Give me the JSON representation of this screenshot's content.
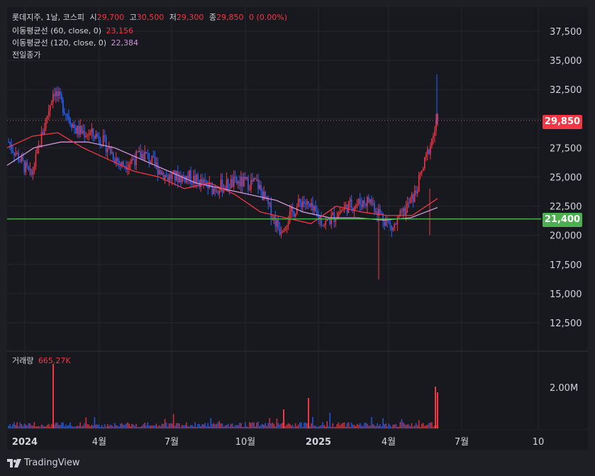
{
  "legend": {
    "symbol": "롯데지주",
    "interval": "1날",
    "market": "코스피",
    "open_label": "시",
    "open": "29,700",
    "high_label": "고",
    "high": "30,500",
    "low_label": "저",
    "low": "29,300",
    "close_label": "종",
    "close": "29,850",
    "change": "0 (0.00%)",
    "ma60_label": "이동평균선 (60, close, 0)",
    "ma60_value": "23,156",
    "ma120_label": "이동평균선 (120, close, 0)",
    "ma120_value": "22,384",
    "prev_close_label": "전일종가",
    "volume_label": "거래량",
    "volume_value": "665.27K"
  },
  "price_axis": [
    "37,500",
    "35,000",
    "32,500",
    "30,000",
    "27,500",
    "25,000",
    "22,500",
    "20,000",
    "17,500",
    "15,000",
    "12,500"
  ],
  "price_axis_values": [
    37500,
    35000,
    32500,
    30000,
    27500,
    25000,
    22500,
    20000,
    17500,
    15000,
    12500
  ],
  "last_price_tag": "29,850",
  "hline_tag": "21,400",
  "volume_axis": [
    "2.00M"
  ],
  "time_axis": [
    "2024",
    "4월",
    "7월",
    "10월",
    "2025",
    "4월",
    "7월",
    "10"
  ],
  "brand": "TradingView",
  "colors": {
    "up": "#f23645",
    "down": "#2962ff",
    "ma60": "#f23645",
    "ma120": "#ce93d8",
    "hline": "#4caf50",
    "background": "#18191f",
    "text": "#d1d4dc"
  },
  "chart_data": {
    "type": "candlestick",
    "price_range": [
      10000,
      39000
    ],
    "close_series_approx": [
      {
        "t": "2024-01",
        "close": 28000
      },
      {
        "t": "2024-01-mid",
        "close": 25000
      },
      {
        "t": "2024-02",
        "close": 32500
      },
      {
        "t": "2024-02-end",
        "close": 29000
      },
      {
        "t": "2024-03",
        "close": 28500
      },
      {
        "t": "2024-04",
        "close": 26000
      },
      {
        "t": "2024-05",
        "close": 27000
      },
      {
        "t": "2024-06",
        "close": 25000
      },
      {
        "t": "2024-07",
        "close": 25000
      },
      {
        "t": "2024-08",
        "close": 24000
      },
      {
        "t": "2024-09",
        "close": 24500
      },
      {
        "t": "2024-10",
        "close": 24500
      },
      {
        "t": "2024-11",
        "close": 20500
      },
      {
        "t": "2024-12",
        "close": 23000
      },
      {
        "t": "2025-01",
        "close": 21000
      },
      {
        "t": "2025-02",
        "close": 22500
      },
      {
        "t": "2025-03",
        "close": 23000
      },
      {
        "t": "2025-04",
        "close": 20500
      },
      {
        "t": "2025-05",
        "close": 23500
      },
      {
        "t": "2025-06",
        "close": 29850
      }
    ],
    "ma60": [
      27500,
      28500,
      28800,
      27500,
      26500,
      25500,
      25000,
      24000,
      24500,
      23500,
      22000,
      21500,
      21000,
      22500,
      22000,
      21700,
      21700,
      23156
    ],
    "ma120": [
      26000,
      27500,
      28000,
      28000,
      27500,
      26500,
      25500,
      24500,
      24000,
      23500,
      23000,
      22000,
      21500,
      21500,
      21300,
      21500,
      22384
    ],
    "horizontal_line": 21400,
    "last_price": 29850,
    "volume_peak": "2.00M"
  }
}
